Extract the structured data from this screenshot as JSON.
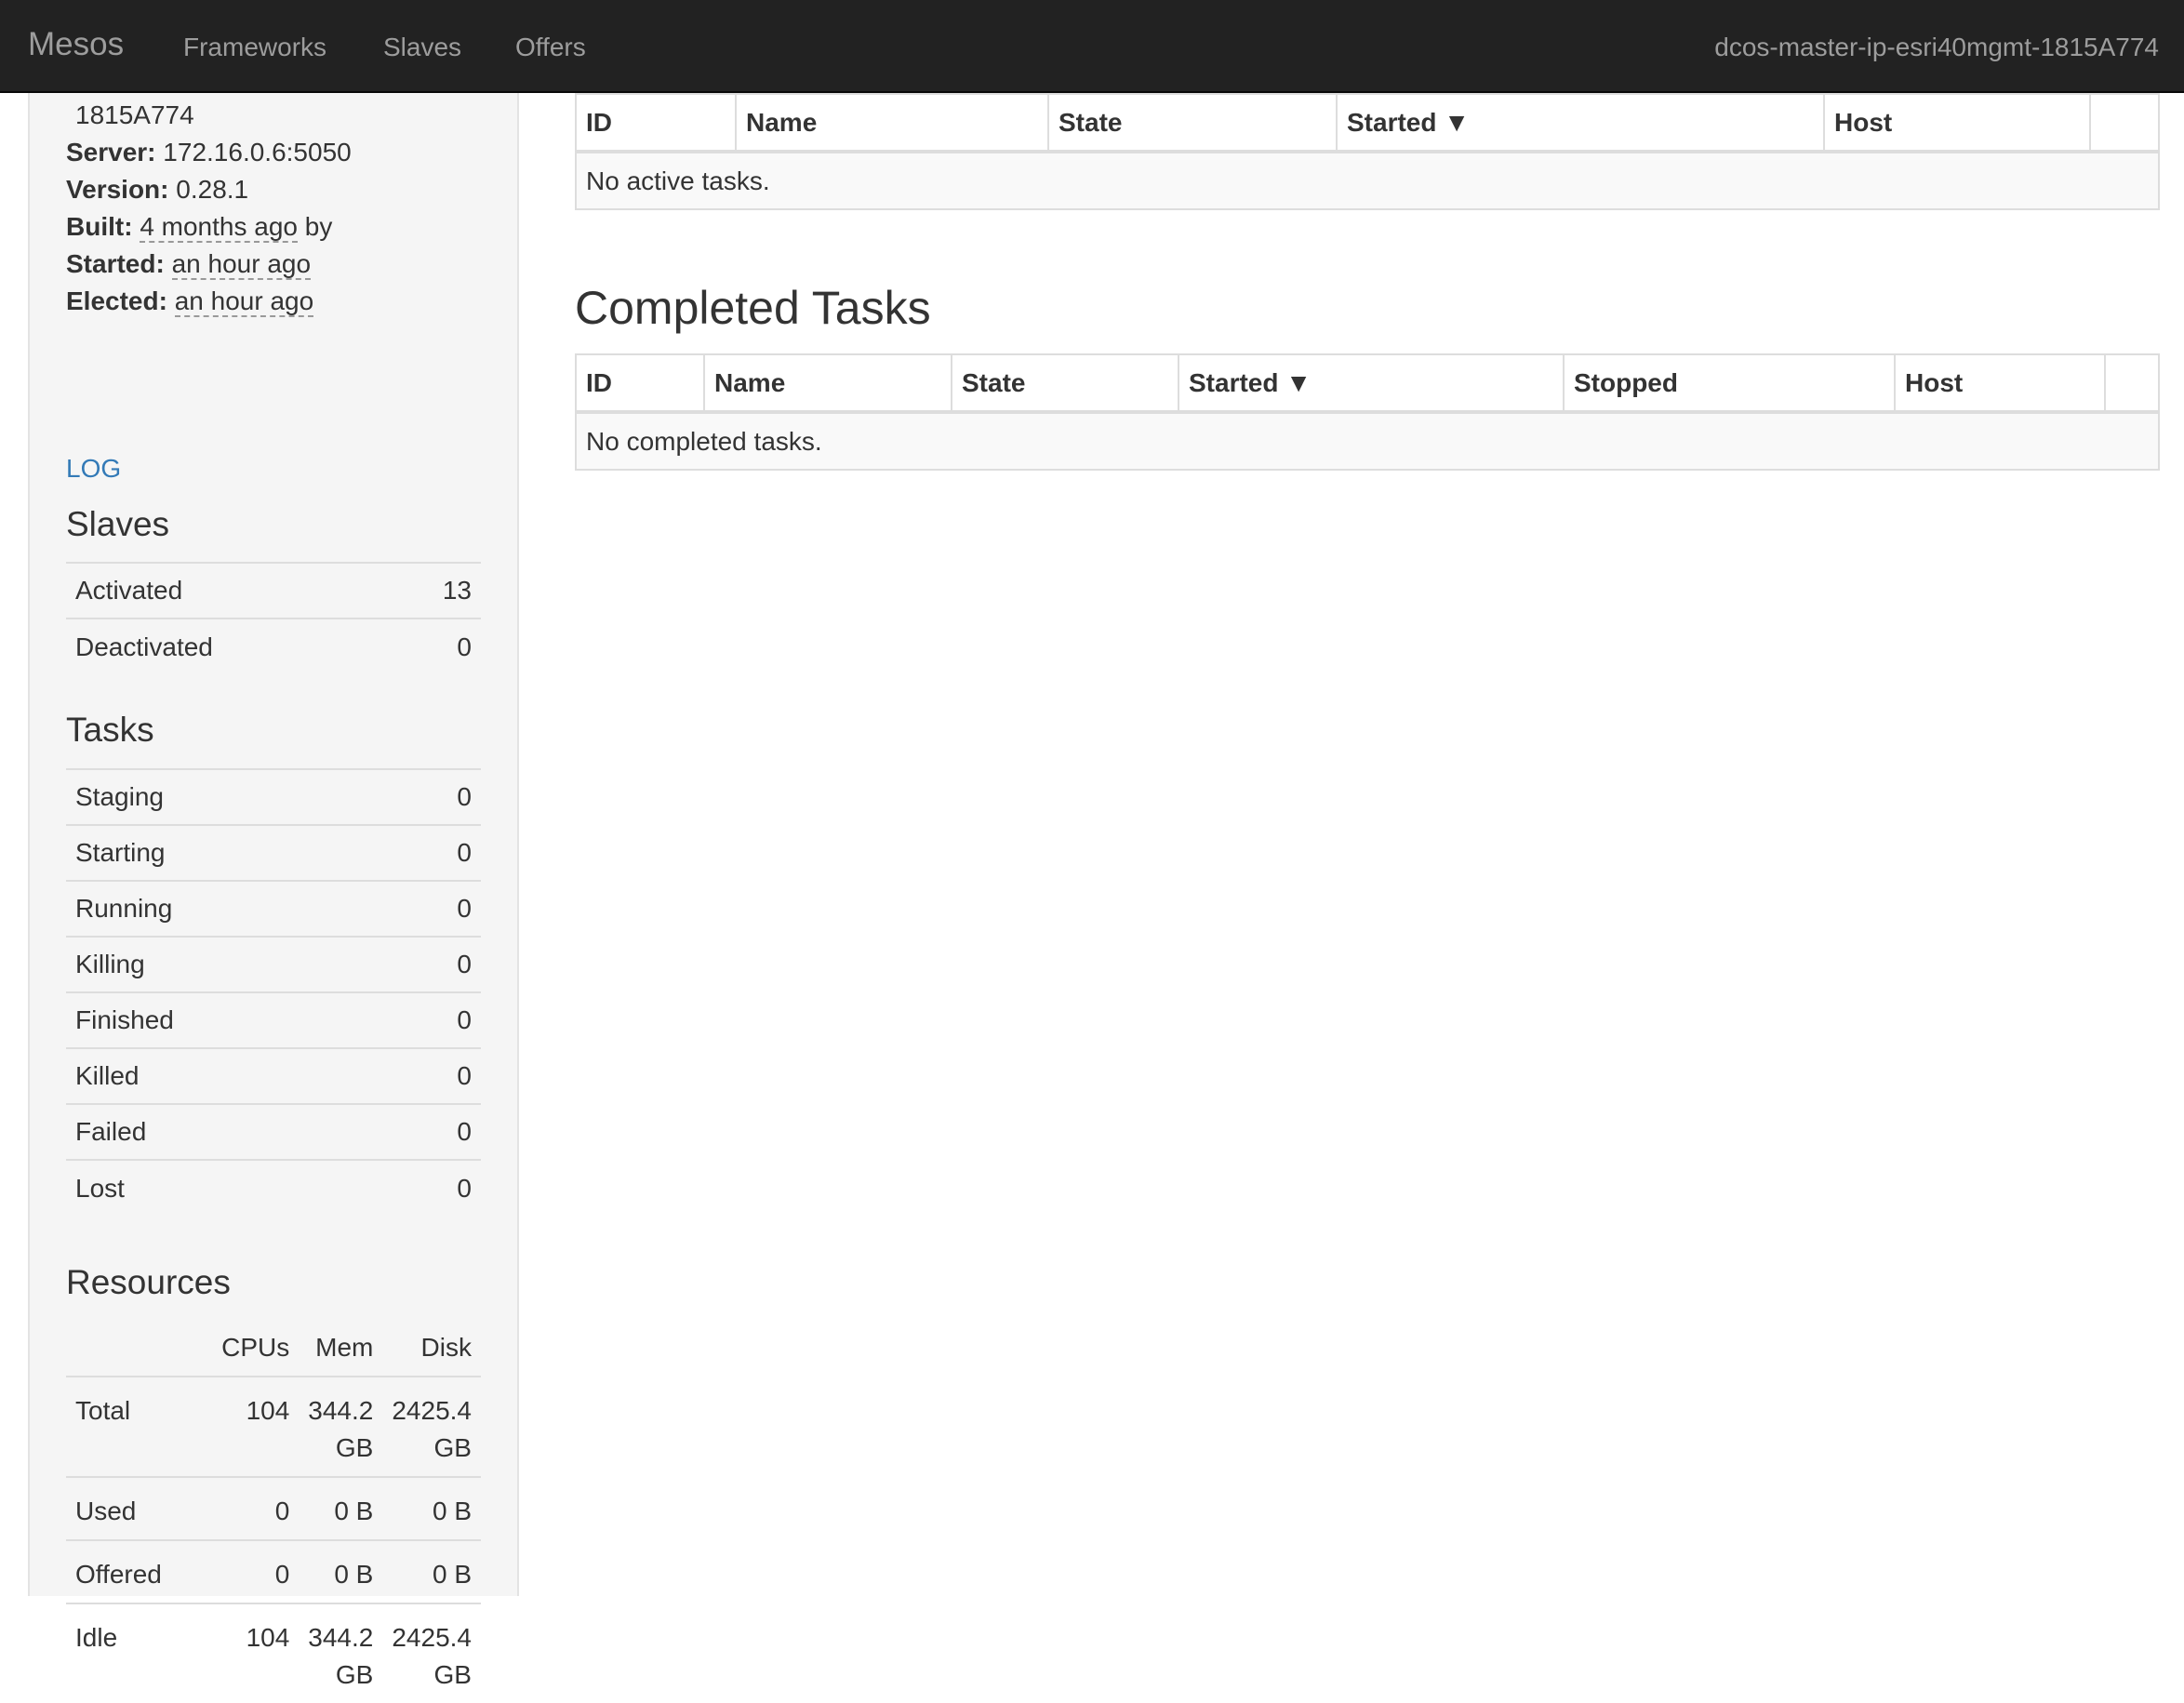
{
  "navbar": {
    "brand": "Mesos",
    "links": [
      "Frameworks",
      "Slaves",
      "Offers"
    ],
    "cluster_name": "dcos-master-ip-esri40mgmt-1815A774"
  },
  "sidebar": {
    "host_fragment": "1815A774",
    "info": {
      "server_label": "Server:",
      "server_value": "172.16.0.6:5050",
      "version_label": "Version:",
      "version_value": "0.28.1",
      "built_label": "Built:",
      "built_value": "4 months ago",
      "built_suffix": "by",
      "started_label": "Started:",
      "started_value": "an hour ago",
      "elected_label": "Elected:",
      "elected_value": "an hour ago"
    },
    "log_link": "LOG",
    "slaves": {
      "heading": "Slaves",
      "rows": [
        {
          "label": "Activated",
          "value": "13"
        },
        {
          "label": "Deactivated",
          "value": "0"
        }
      ]
    },
    "tasks": {
      "heading": "Tasks",
      "rows": [
        {
          "label": "Staging",
          "value": "0"
        },
        {
          "label": "Starting",
          "value": "0"
        },
        {
          "label": "Running",
          "value": "0"
        },
        {
          "label": "Killing",
          "value": "0"
        },
        {
          "label": "Finished",
          "value": "0"
        },
        {
          "label": "Killed",
          "value": "0"
        },
        {
          "label": "Failed",
          "value": "0"
        },
        {
          "label": "Lost",
          "value": "0"
        }
      ]
    },
    "resources": {
      "heading": "Resources",
      "columns": [
        "CPUs",
        "Mem",
        "Disk"
      ],
      "rows": [
        {
          "label": "Total",
          "cpus": "104",
          "mem": "344.2 GB",
          "disk": "2425.4 GB"
        },
        {
          "label": "Used",
          "cpus": "0",
          "mem": "0 B",
          "disk": "0 B"
        },
        {
          "label": "Offered",
          "cpus": "0",
          "mem": "0 B",
          "disk": "0 B"
        },
        {
          "label": "Idle",
          "cpus": "104",
          "mem": "344.2 GB",
          "disk": "2425.4 GB"
        }
      ]
    }
  },
  "main": {
    "active": {
      "columns": [
        "ID",
        "Name",
        "State",
        "Started ▼",
        "Host"
      ],
      "empty_text": "No active tasks."
    },
    "completed": {
      "title": "Completed Tasks",
      "columns": [
        "ID",
        "Name",
        "State",
        "Started ▼",
        "Stopped",
        "Host"
      ],
      "empty_text": "No completed tasks."
    }
  }
}
